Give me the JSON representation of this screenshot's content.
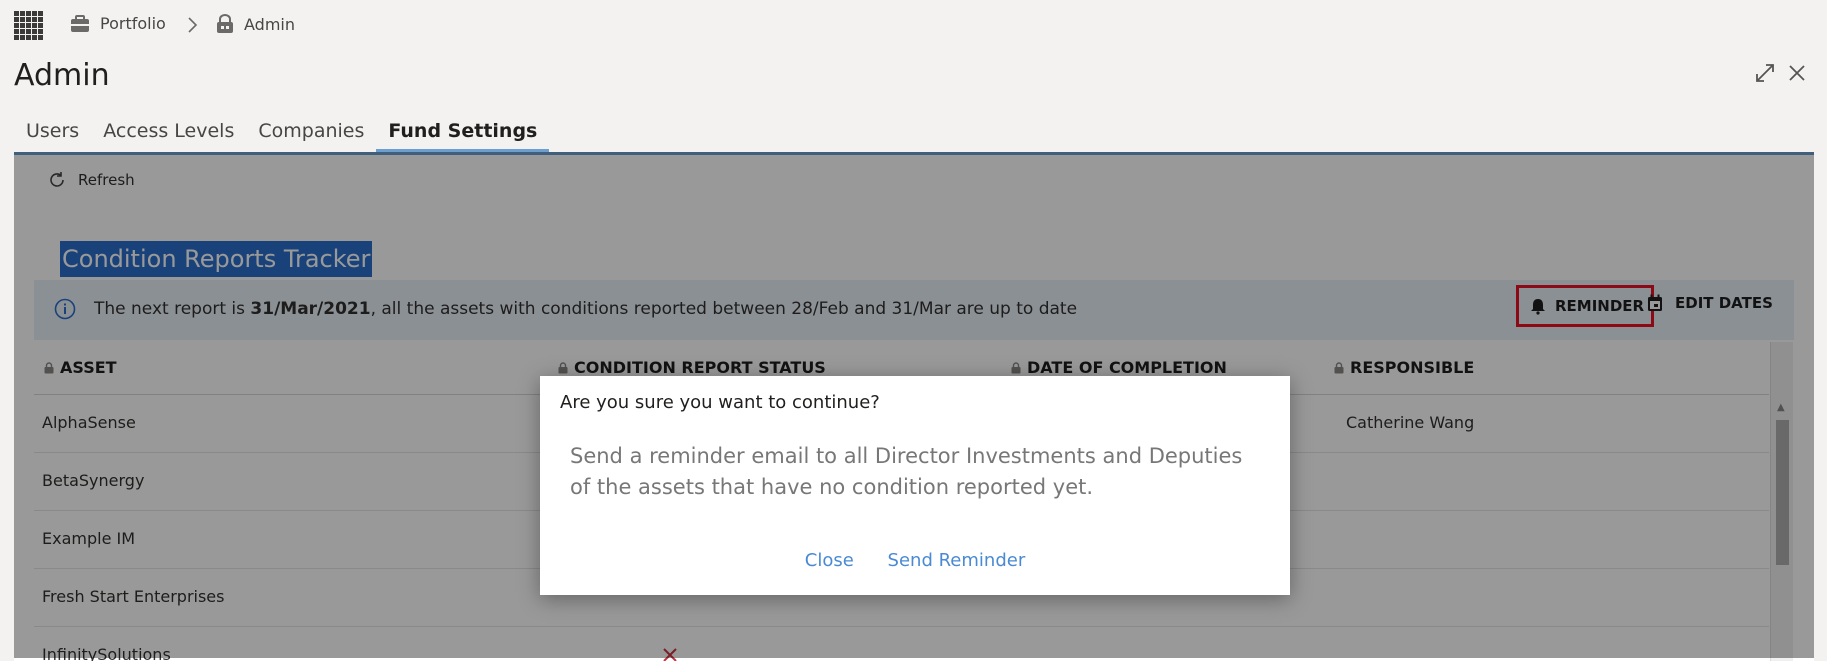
{
  "breadcrumb": {
    "items": [
      {
        "label": "Portfolio",
        "icon": "briefcase-icon"
      },
      {
        "label": "Admin",
        "icon": "lock-icon"
      }
    ]
  },
  "page": {
    "title": "Admin"
  },
  "tabs": [
    {
      "label": "Users",
      "active": false
    },
    {
      "label": "Access Levels",
      "active": false
    },
    {
      "label": "Companies",
      "active": false
    },
    {
      "label": "Fund Settings",
      "active": true
    }
  ],
  "toolbar": {
    "refresh_label": "Refresh"
  },
  "tracker": {
    "title": "Condition Reports Tracker",
    "info": {
      "prefix": "The next report is ",
      "date": "31/Mar/2021",
      "suffix": ", all the assets with conditions reported between 28/Feb and 31/Mar are up to date"
    },
    "reminder_label": "REMINDER",
    "edit_dates_label": "EDIT DATES",
    "columns": [
      "ASSET",
      "CONDITION REPORT STATUS",
      "DATE OF COMPLETION",
      "RESPONSIBLE"
    ],
    "rows": [
      {
        "asset": "AlphaSense",
        "responsible": "Catherine Wang"
      },
      {
        "asset": "BetaSynergy",
        "responsible": ""
      },
      {
        "asset": "Example IM",
        "responsible": ""
      },
      {
        "asset": "Fresh Start Enterprises",
        "responsible": ""
      },
      {
        "asset": "InfinitySolutions",
        "responsible": ""
      }
    ]
  },
  "dialog": {
    "title": "Are you sure you want to continue?",
    "body": "Send a reminder email to all Director Investments and Deputies of the assets that have no condition reported yet.",
    "close_label": "Close",
    "confirm_label": "Send Reminder"
  },
  "colors": {
    "accent": "#6c9ed0",
    "link": "#4a8ad4",
    "highlight": "#e81123",
    "status_fail": "#c8323c"
  }
}
